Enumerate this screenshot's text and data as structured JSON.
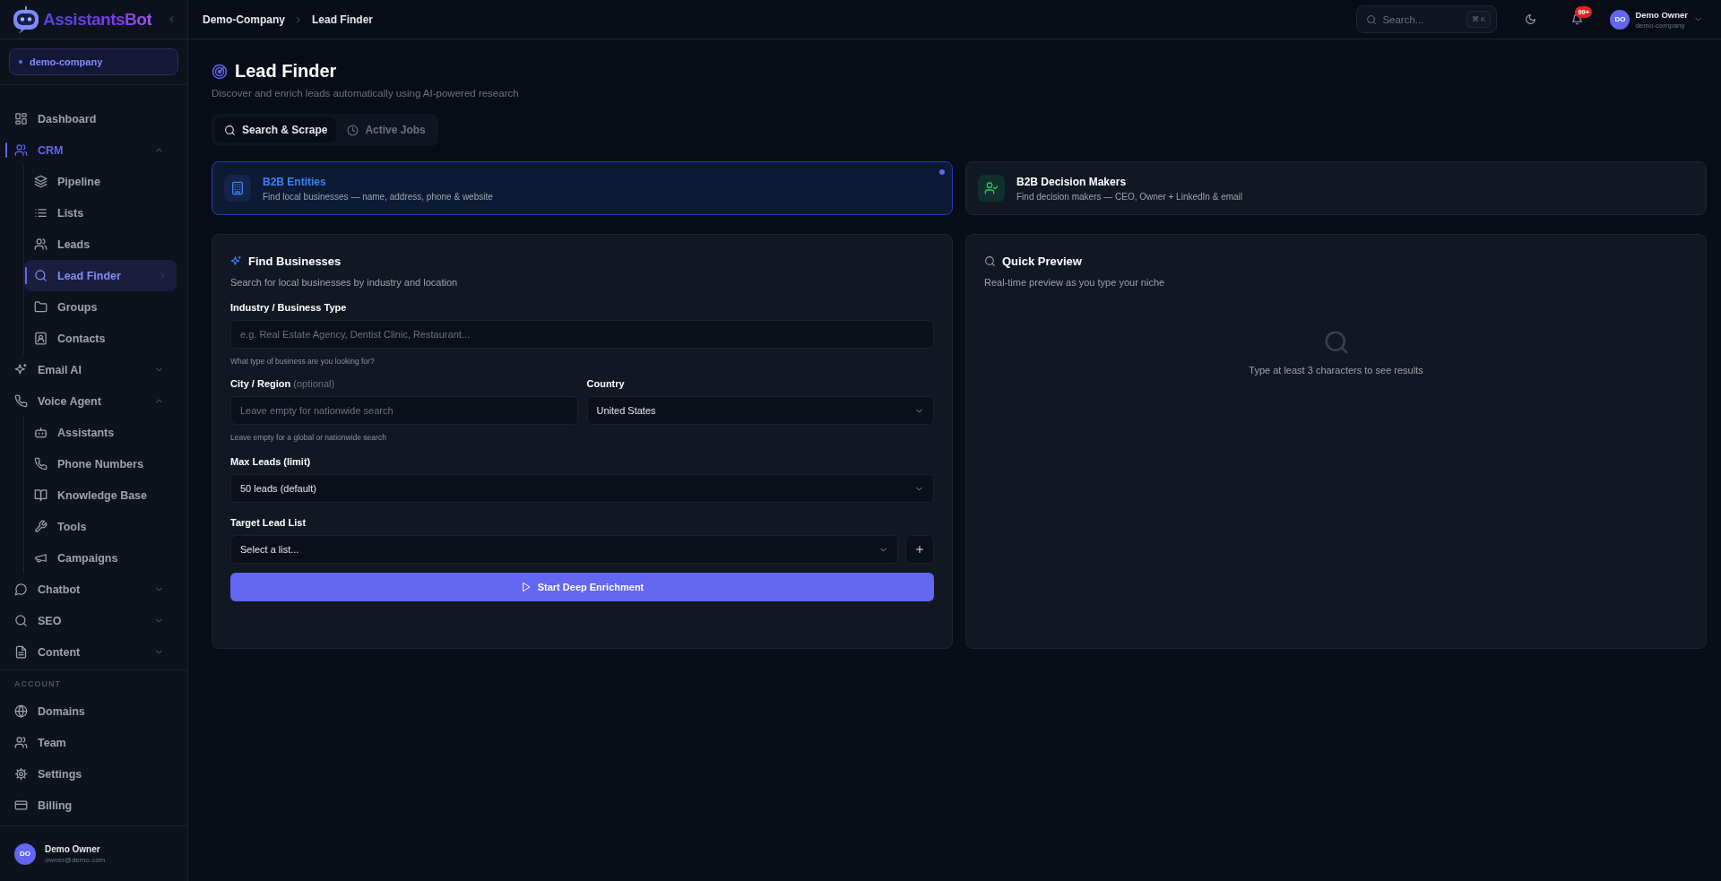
{
  "brand": {
    "name": "AssistantsBot"
  },
  "workspace": {
    "name": "demo-company"
  },
  "nav": [
    {
      "label": "Dashboard",
      "selected": false
    },
    {
      "label": "CRM",
      "selected": true,
      "expanded": true,
      "children": [
        {
          "label": "Pipeline",
          "selected": false
        },
        {
          "label": "Lists",
          "selected": false
        },
        {
          "label": "Leads",
          "selected": false
        },
        {
          "label": "Lead Finder",
          "selected": true
        },
        {
          "label": "Groups",
          "selected": false
        },
        {
          "label": "Contacts",
          "selected": false
        }
      ]
    },
    {
      "label": "Email AI",
      "selected": false,
      "expanded": false
    },
    {
      "label": "Voice Agent",
      "selected": false,
      "expanded": true,
      "children": [
        {
          "label": "Assistants",
          "selected": false
        },
        {
          "label": "Phone Numbers",
          "selected": false
        },
        {
          "label": "Knowledge Base",
          "selected": false
        },
        {
          "label": "Tools",
          "selected": false
        },
        {
          "label": "Campaigns",
          "selected": false
        }
      ]
    },
    {
      "label": "Chatbot",
      "selected": false,
      "expanded": false
    },
    {
      "label": "SEO",
      "selected": false,
      "expanded": false
    },
    {
      "label": "Content",
      "selected": false,
      "expanded": false
    }
  ],
  "account": {
    "heading": "ACCOUNT",
    "items": [
      {
        "label": "Domains",
        "selected": false
      },
      {
        "label": "Team",
        "selected": false
      },
      {
        "label": "Settings",
        "selected": false
      },
      {
        "label": "Billing",
        "selected": false
      }
    ]
  },
  "sidebar_user": {
    "initials": "DO",
    "name": "Demo Owner",
    "email": "owner@demo.com"
  },
  "breadcrumb": [
    "Demo-Company",
    "Lead Finder"
  ],
  "header": {
    "search_placeholder": "Search...",
    "shortcut": "⌘ K",
    "notifications": "99+",
    "user": {
      "initials": "DO",
      "name": "Demo Owner",
      "org": "demo-company"
    }
  },
  "page": {
    "title": "Lead Finder",
    "subtitle": "Discover and enrich leads automatically using AI-powered research"
  },
  "tabs": [
    {
      "label": "Search & Scrape",
      "selected": true
    },
    {
      "label": "Active Jobs",
      "selected": false
    }
  ],
  "modes": [
    {
      "title": "B2B Entities",
      "description": "Find local businesses — name, address, phone & website",
      "selected": true
    },
    {
      "title": "B2B Decision Makers",
      "description": "Find decision makers — CEO, Owner + LinkedIn & email",
      "selected": false
    }
  ],
  "form": {
    "title": "Find Businesses",
    "subtitle": "Search for local businesses by industry and location",
    "industry": {
      "label": "Industry / Business Type",
      "placeholder": "e.g. Real Estate Agency, Dentist Clinic, Restaurant...",
      "hint": "What type of business are you looking for?"
    },
    "city": {
      "label": "City / Region",
      "note": "(optional)",
      "placeholder": "Leave empty for nationwide search",
      "hint": "Leave empty for a global or nationwide search"
    },
    "country": {
      "label": "Country",
      "value": "United States"
    },
    "max_leads": {
      "label": "Max Leads (limit)",
      "value": "50 leads (default)"
    },
    "target_list": {
      "label": "Target Lead List",
      "value": "Select a list..."
    },
    "submit": "Start Deep Enrichment"
  },
  "preview": {
    "title": "Quick Preview",
    "subtitle": "Real-time preview as you type your niche",
    "empty_message": "Type at least 3 characters to see results"
  }
}
